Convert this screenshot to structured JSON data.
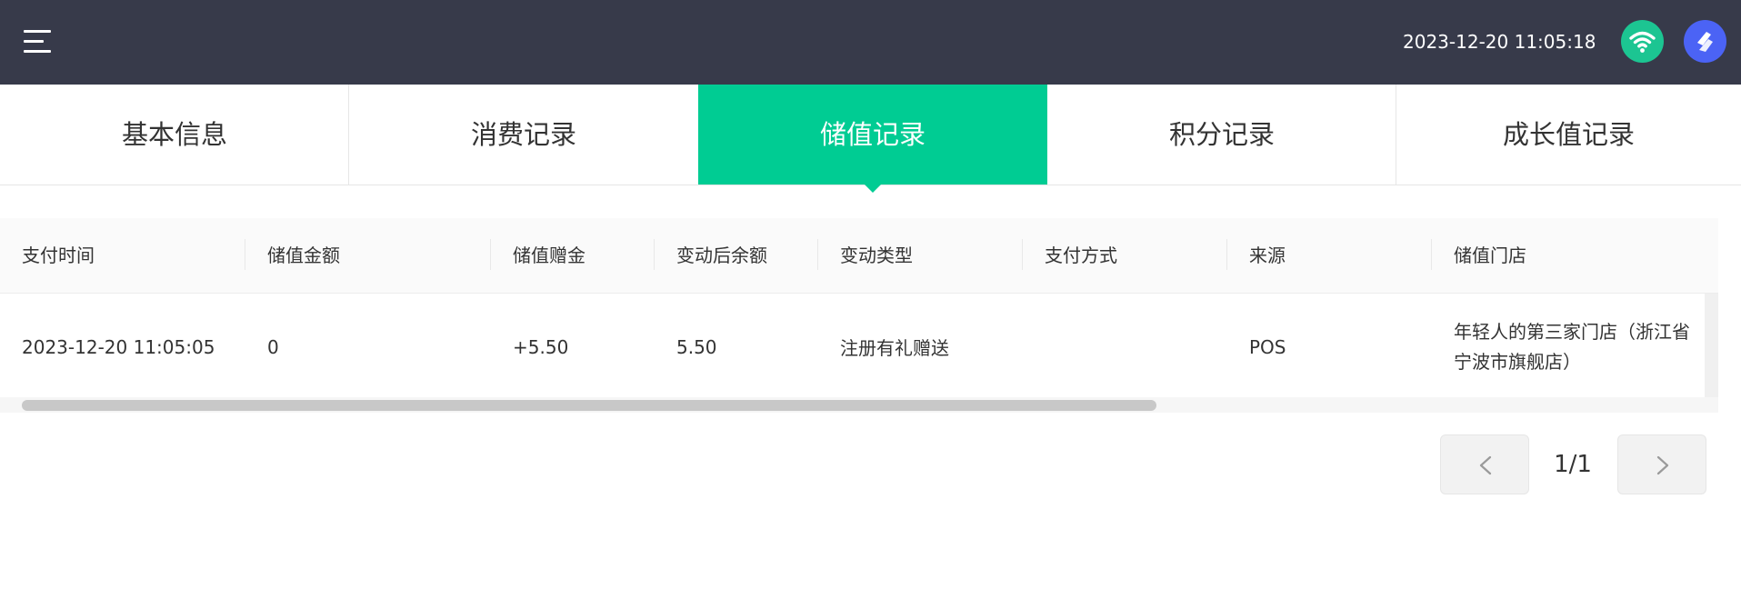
{
  "header": {
    "datetime": "2023-12-20 11:05:18",
    "menu_icon": "hamburger-menu-icon",
    "wifi_icon": "wifi-icon",
    "app_icon": "app-logo-icon",
    "wifi_color": "#1cc592",
    "app_color": "#4b63f5",
    "bar_color": "#373a4a"
  },
  "tabs": [
    {
      "label": "基本信息",
      "active": false
    },
    {
      "label": "消费记录",
      "active": false
    },
    {
      "label": "储值记录",
      "active": true
    },
    {
      "label": "积分记录",
      "active": false
    },
    {
      "label": "成长值记录",
      "active": false
    }
  ],
  "accent_color": "#00cc93",
  "table": {
    "columns": [
      "支付时间",
      "储值金额",
      "储值赠金",
      "变动后余额",
      "变动类型",
      "支付方式",
      "来源",
      "储值门店"
    ],
    "rows": [
      [
        "2023-12-20 11:05:05",
        "0",
        "+5.50",
        "5.50",
        "注册有礼赠送",
        "",
        "POS",
        "年轻人的第三家门店（浙江省宁波市旗舰店）"
      ]
    ]
  },
  "pagination": {
    "label": "1/1",
    "prev_icon": "chevron-left-icon",
    "next_icon": "chevron-right-icon"
  }
}
